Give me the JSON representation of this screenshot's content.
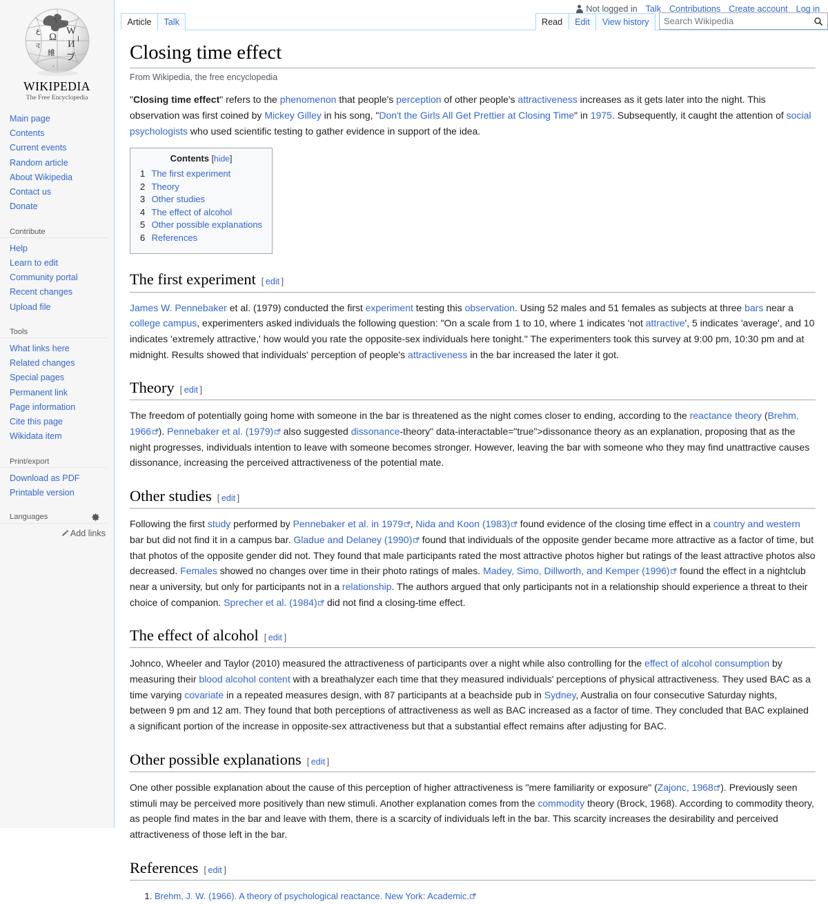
{
  "personal_bar": {
    "status": "Not logged in",
    "links": [
      "Talk",
      "Contributions",
      "Create account",
      "Log in"
    ]
  },
  "sidebar": {
    "wordmark_line": "WIKIPEDIA",
    "tagline": "The Free Encyclopedia",
    "portals": [
      {
        "heading": "",
        "items": [
          "Main page",
          "Contents",
          "Current events",
          "Random article",
          "About Wikipedia",
          "Contact us",
          "Donate"
        ]
      },
      {
        "heading": "Contribute",
        "items": [
          "Help",
          "Learn to edit",
          "Community portal",
          "Recent changes",
          "Upload file"
        ]
      },
      {
        "heading": "Tools",
        "items": [
          "What links here",
          "Related changes",
          "Special pages",
          "Permanent link",
          "Page information",
          "Cite this page",
          "Wikidata item"
        ]
      },
      {
        "heading": "Print/export",
        "items": [
          "Download as PDF",
          "Printable version"
        ]
      }
    ],
    "languages": {
      "heading": "Languages",
      "add_links": "Add links"
    }
  },
  "tabs": {
    "namespaces": [
      {
        "label": "Article",
        "selected": true
      },
      {
        "label": "Talk",
        "selected": false
      }
    ],
    "views": [
      {
        "label": "Read",
        "selected": true
      },
      {
        "label": "Edit",
        "selected": false
      },
      {
        "label": "View history",
        "selected": false
      }
    ]
  },
  "search": {
    "placeholder": "Search Wikipedia",
    "value": ""
  },
  "article": {
    "title": "Closing time effect",
    "site_sub": "From Wikipedia, the free encyclopedia",
    "intro": {
      "lead_bold": "Closing time effect",
      "full": "\"Closing time effect\" refers to the phenomenon that people's perception of other people's attractiveness increases as it gets later into the night. This observation was first coined by Mickey Gilley in his song, \"Don't the Girls All Get Prettier at Closing Time\" in 1975. Subsequently, it caught the attention of social psychologists who used scientific testing to gather evidence in support of the idea."
    },
    "toc": {
      "title": "Contents",
      "toggle": "hide",
      "entries": [
        {
          "number": "1",
          "text": "The first experiment"
        },
        {
          "number": "2",
          "text": "Theory"
        },
        {
          "number": "3",
          "text": "Other studies"
        },
        {
          "number": "4",
          "text": "The effect of alcohol"
        },
        {
          "number": "5",
          "text": "Other possible explanations"
        },
        {
          "number": "6",
          "text": "References"
        }
      ]
    },
    "edit_label": "edit",
    "sections": [
      {
        "heading": "The first experiment",
        "paragraph": "James W. Pennebaker et al. (1979) conducted the first experiment testing this observation. Using 52 males and 51 females as subjects at three bars near a college campus, experimenters asked individuals the following question: \"On a scale from 1 to 10, where 1 indicates 'not attractive', 5 indicates 'average', and 10 indicates 'extremely attractive,' how would you rate the opposite-sex individuals here tonight.\" The experimenters took this survey at 9:00 pm, 10:30 pm and at midnight. Results showed that individuals' perception of people's attractiveness in the bar increased the later it got."
      },
      {
        "heading": "Theory",
        "paragraph": "The freedom of potentially going home with someone in the bar is threatened as the night comes closer to ending, according to the reactance theory (Brehm, 1966). Pennebaker et al. (1979) also suggested dissonance theory as an explanation, proposing that as the night progresses, individuals intention to leave with someone becomes stronger. However, leaving the bar with someone who they may find unattractive causes dissonance, increasing the perceived attractiveness of the potential mate."
      },
      {
        "heading": "Other studies",
        "paragraph": "Following the first study performed by Pennebaker et al. in 1979, Nida and Koon (1983) found evidence of the closing time effect in a country and western bar but did not find it in a campus bar. Gladue and Delaney (1990) found that individuals of the opposite gender became more attractive as a factor of time, but that photos of the opposite gender did not. They found that male participants rated the most attractive photos higher but ratings of the least attractive photos also decreased. Females showed no changes over time in their photo ratings of males. Madey, Simo, Dillworth, and Kemper (1996) found the effect in a nightclub near a university, but only for participants not in a relationship. The authors argued that only participants not in a relationship should experience a threat to their choice of companion. Sprecher et al. (1984) did not find a closing-time effect."
      },
      {
        "heading": "The effect of alcohol",
        "paragraph": "Johnco, Wheeler and Taylor (2010) measured the attractiveness of participants over a night while also controlling for the effect of alcohol consumption by measuring their blood alcohol content with a breathalyzer each time that they measured individuals' perceptions of physical attractiveness. They used BAC as a time varying covariate in a repeated measures design, with 87 participants at a beachside pub in Sydney, Australia on four consecutive Saturday nights, between 9 pm and 12 am. They found that both perceptions of attractiveness as well as BAC increased as a factor of time. They concluded that BAC explained a significant portion of the increase in opposite-sex attractiveness but that a substantial effect remains after adjusting for BAC."
      },
      {
        "heading": "Other possible explanations",
        "paragraph": "One other possible explanation about the cause of this perception of higher attractiveness is \"mere familiarity or exposure\" (Zajonc, 1968). Previously seen stimuli may be perceived more positively than new stimuli. Another explanation comes from the commodity theory (Brock, 1968). According to commodity theory, as people find mates in the bar and leave with them, there is a scarcity of individuals left in the bar. This scarcity increases the desirability and perceived attractiveness of those left in the bar."
      },
      {
        "heading": "References",
        "paragraph": ""
      }
    ],
    "references": [
      "Brehm, J. W. (1966). A theory of psychological reactance. New York: Academic."
    ]
  }
}
